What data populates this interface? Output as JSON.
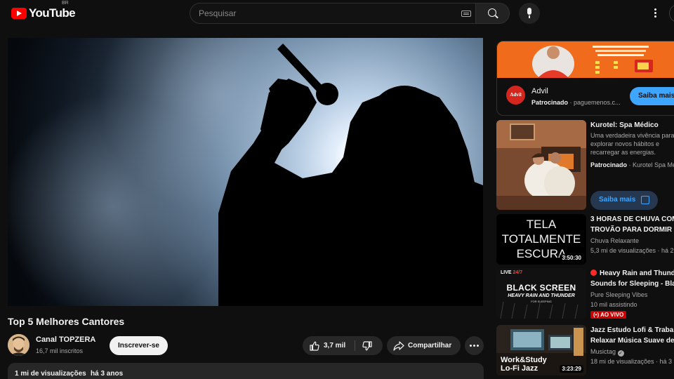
{
  "header": {
    "logo_text": "YouTube",
    "country_code": "BR",
    "search_placeholder": "Pesquisar"
  },
  "video": {
    "title": "Top 5 Melhores Cantores",
    "channel_name": "Canal TOPZERA",
    "subscribers": "16,7 mil inscritos",
    "subscribe_label": "Inscrever-se",
    "likes": "3,7 mil",
    "share_label": "Compartilhar",
    "views": "1 mi de visualizações",
    "published": "há 3 anos"
  },
  "ad": {
    "title": "Advil",
    "avatar_label": "Advil",
    "sponsored": "Patrocinado",
    "domain": "paguemenos.c...",
    "cta": "Saiba mais"
  },
  "promoted": {
    "title": "Kurotel: Spa Médico",
    "description": "Uma verdadeira vivência para explorar novos hábitos e recarregar as energias.",
    "sponsored": "Patrocinado",
    "advertiser": "Kurotel Spa Mé",
    "cta": "Saiba mais"
  },
  "recommendations": [
    {
      "title_line1": "3 HORAS DE CHUVA COM",
      "title_line2": "TROVÃO PARA DORMIR E",
      "channel": "Chuva Relaxante",
      "meta": "5,3 mi de visualizações",
      "meta_age": "há 2",
      "duration": "3:50:30",
      "thumb_text": [
        "TELA",
        "TOTALMENTE",
        "ESCURA"
      ]
    },
    {
      "title_line1": "Heavy Rain and Thund",
      "title_line2": "Sounds for Sleeping - Bla",
      "channel": "Pure Sleeping Vibes",
      "meta": "10 mil assistindo",
      "live": "AO VIVO",
      "thumb_live": "LIVE",
      "thumb_live_hours": "24/7",
      "thumb_title": "BLACK SCREEN",
      "thumb_subtitle": "HEAVY RAIN AND THUNDER",
      "thumb_caption": "FOR SLEEPING"
    },
    {
      "title_line1": "Jazz Estudo Lofi & Trabal",
      "title_line2": "Relaxar Música Suave de",
      "channel": "Musictag",
      "meta": "18 mi de visualizações",
      "meta_age": "há 3",
      "duration": "3:23:29",
      "thumb_text_line1": "Work&Study",
      "thumb_text_line2": "Lo-Fi Jazz"
    }
  ],
  "colors": {
    "background": "#0f0f0f",
    "accent_blue": "#3ea6ff",
    "brand_red": "#ff0000",
    "live_red": "#cc0000"
  }
}
